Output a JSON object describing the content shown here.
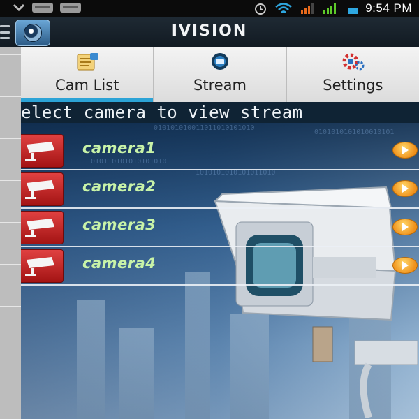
{
  "status_bar": {
    "time": "9:54 PM",
    "icons": [
      "chevron-down-icon",
      "sd-card-icon",
      "sd-card-icon",
      "alarm-icon",
      "wifi-icon",
      "signal-icon",
      "signal-icon",
      "battery-icon"
    ]
  },
  "app_bar": {
    "title": "IVISION",
    "logo_icon": "camera-lens-icon"
  },
  "tabs": [
    {
      "label": "Cam List",
      "icon": "cam-list-icon",
      "active": true
    },
    {
      "label": "Stream",
      "icon": "stream-icon",
      "active": false
    },
    {
      "label": "Settings",
      "icon": "settings-icon",
      "active": false
    }
  ],
  "banner": {
    "text": "elect camera to view stream"
  },
  "cameras": [
    {
      "name": "camera1",
      "action_icon": "play-icon"
    },
    {
      "name": "camera2",
      "action_icon": "play-icon"
    },
    {
      "name": "camera3",
      "action_icon": "play-icon"
    },
    {
      "name": "camera4",
      "action_icon": "play-icon"
    }
  ],
  "colors": {
    "accent": "#2ca3d6",
    "camera_label": "#c8f3a8",
    "camera_thumb": "#c62626",
    "play_button": "#f0901a"
  }
}
